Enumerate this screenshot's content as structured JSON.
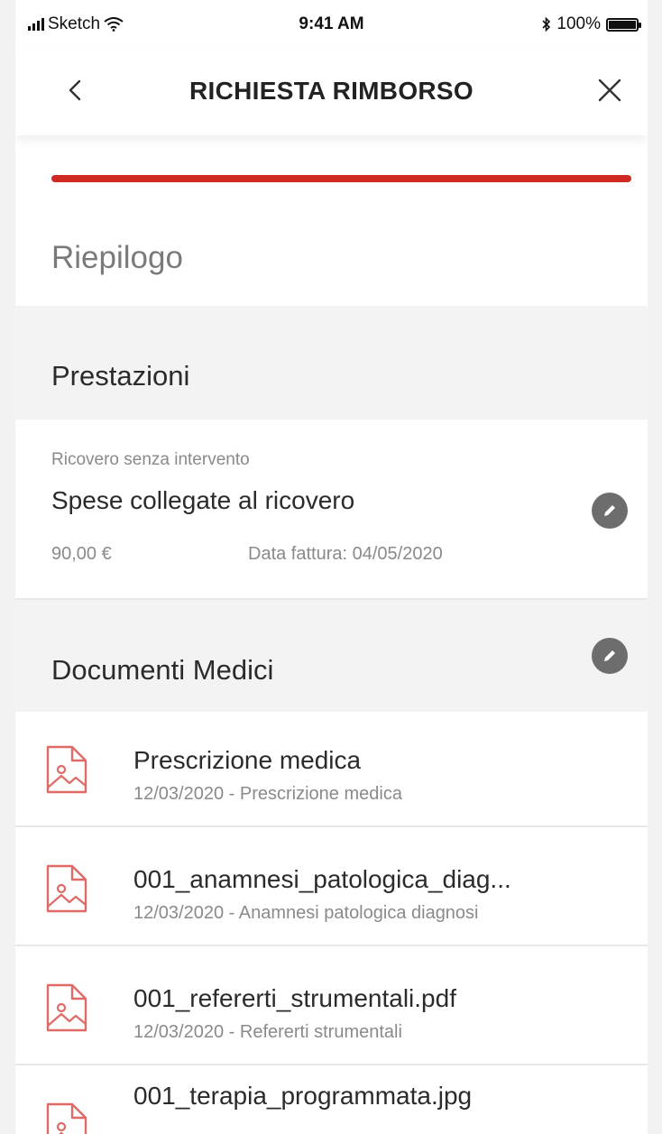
{
  "status_bar": {
    "carrier": "Sketch",
    "time": "9:41 AM",
    "battery": "100%",
    "battery_level": 1.0
  },
  "navbar": {
    "back_icon": "chevron-left-icon",
    "title": "RICHIESTA RIMBORSO",
    "close_icon": "close-icon"
  },
  "progress": {
    "fraction": 1.0,
    "color": "#d12a24"
  },
  "page_title": "Riepilogo",
  "prestazioni": {
    "header": "Prestazioni",
    "item": {
      "category": "Ricovero senza intervento",
      "name": "Spese collegate al ricovero",
      "amount": "90,00 €",
      "invoice_date": "Data fattura: 04/05/2020",
      "edit_icon": "pencil-icon"
    }
  },
  "documenti": {
    "header": "Documenti Medici",
    "edit_icon": "pencil-icon",
    "items": [
      {
        "title": "Prescrizione medica",
        "subtitle": "12/03/2020 - Prescrizione medica",
        "icon": "image-file-icon"
      },
      {
        "title": "001_anamnesi_patologica_diag...",
        "subtitle": "12/03/2020 - Anamnesi patologica diagnosi",
        "icon": "image-file-icon"
      },
      {
        "title": "001_refererti_strumentali.pdf",
        "subtitle": "12/03/2020 - Refererti strumentali",
        "icon": "image-file-icon"
      },
      {
        "title": "001_terapia_programmata.jpg",
        "subtitle": "",
        "icon": "image-file-icon"
      }
    ]
  },
  "colors": {
    "accent": "#d12a24",
    "section_bg": "#f3f3f3",
    "edit_button": "#6d6d6d"
  }
}
